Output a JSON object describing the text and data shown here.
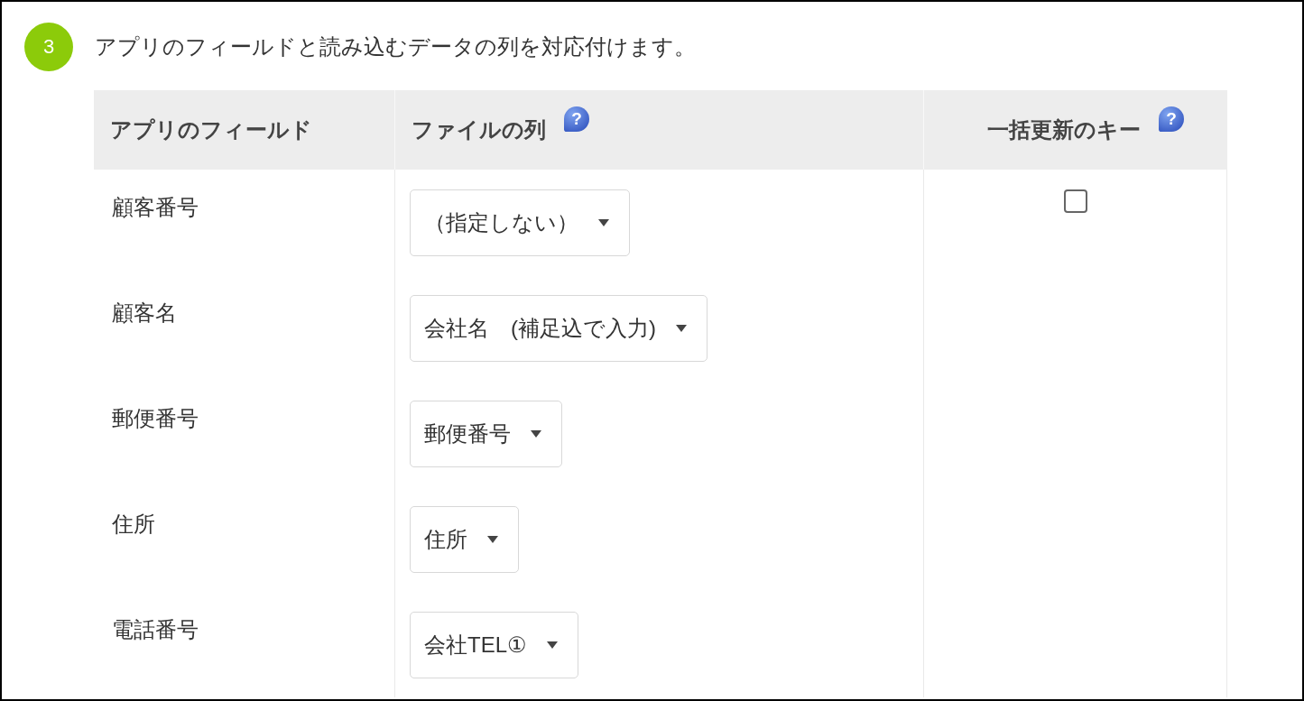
{
  "step": {
    "number": "3",
    "text": "アプリのフィールドと読み込むデータの列を対応付けます。"
  },
  "table": {
    "columns": [
      {
        "label": "アプリのフィールド"
      },
      {
        "label": "ファイルの列",
        "help": "?"
      },
      {
        "label": "一括更新のキー",
        "help": "?"
      }
    ],
    "rows": [
      {
        "field": "顧客番号",
        "column": "（指定しない）",
        "key": {
          "checked": false
        }
      },
      {
        "field": "顧客名",
        "column": "会社名　(補足込で入力)"
      },
      {
        "field": "郵便番号",
        "column": "郵便番号"
      },
      {
        "field": "住所",
        "column": "住所"
      },
      {
        "field": "電話番号",
        "column": "会社TEL①"
      }
    ]
  }
}
